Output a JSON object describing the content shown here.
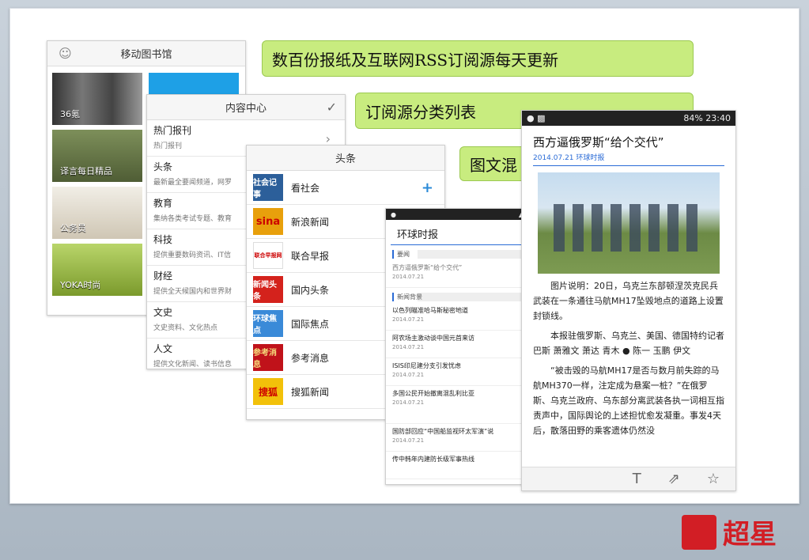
{
  "callouts": {
    "c1": "数百份报纸及互联网RSS订阅源每天更新",
    "c2": "订阅源分类列表",
    "c3": "图文混"
  },
  "library": {
    "title": "移动图书馆",
    "tiles": [
      {
        "label": "36氪"
      },
      {
        "label": "译言每日精品"
      },
      {
        "label": "公务员"
      },
      {
        "label": "YOKA时尚"
      }
    ]
  },
  "content_center": {
    "title": "内容中心",
    "categories": [
      {
        "title": "热门报刊",
        "desc": "热门报刊"
      },
      {
        "title": "头条",
        "desc": "最新最全要闻频道，网罗"
      },
      {
        "title": "教育",
        "desc": "集纳各类考试专题、教育"
      },
      {
        "title": "科技",
        "desc": "提供重要数码资讯、IT信"
      },
      {
        "title": "财经",
        "desc": "提供全天候国内和世界财"
      },
      {
        "title": "文史",
        "desc": "文史资料、文化热点"
      },
      {
        "title": "人文",
        "desc": "提供文化新闻、读书信息"
      }
    ]
  },
  "headlines": {
    "title": "头条",
    "items": [
      {
        "name": "看社会",
        "logo": "社会记事",
        "color": "#2c5f9a"
      },
      {
        "name": "新浪新闻",
        "logo": "sina",
        "color": "#e8a00c"
      },
      {
        "name": "联合早报",
        "logo": "联合早报网",
        "color": "#ffffff"
      },
      {
        "name": "国内头条",
        "logo": "新闻头条",
        "color": "#d4221c"
      },
      {
        "name": "国际焦点",
        "logo": "环球焦点",
        "color": "#3a8ad8"
      },
      {
        "name": "参考消息",
        "logo": "参考消息",
        "color": "#c0121a"
      },
      {
        "name": "搜狐新闻",
        "logo": "搜狐",
        "color": "#f2c10a"
      }
    ]
  },
  "news": {
    "title": "环球时报",
    "sec1": "要闻",
    "sec2": "新闻背景",
    "items": [
      {
        "t": "西方逼俄罗斯“给个交代”",
        "d": "2014.07.21"
      },
      {
        "t": "以色列瞄准哈马斯秘密地道",
        "d": "2014.07.21"
      },
      {
        "t": "阿农场主激动谈中国元首来访",
        "d": "2014.07.21"
      },
      {
        "t": "ISIS印尼建分支引发忧虑",
        "d": "2014.07.21"
      },
      {
        "t": "多国公民开始撤离混乱利比亚",
        "d": "2014.07.21"
      },
      {
        "t": "国防部回应“中国船监视环太军演”说",
        "d": "2014.07.21"
      },
      {
        "t": "传中韩年内建防长级军事热线",
        "d": ""
      }
    ]
  },
  "article": {
    "status_time": "23:40",
    "status_batt": "84%",
    "title": "西方逼俄罗斯“给个交代”",
    "meta": "2014.07.21 环球时报",
    "p1": "图片说明：20日，乌克兰东部顿涅茨克民兵武装在一条通往马航MH17坠毁地点的道路上设置封锁线。",
    "p2": "本报驻俄罗斯、乌克兰、美国、德国特约记者 巴斯 萧雅文 萧达 青木 ● 陈一 玉鹏 伊文",
    "p3": "“被击毁的马航MH17是否与数月前失踪的马航MH370一样，注定成为悬案一桩？”在俄罗斯、乌克兰政府、乌东部分离武装各执一词相互指责声中，国际舆论的上述担忧愈发凝重。事发4天后，散落田野的乘客遗体仍然没"
  },
  "brand": "超星",
  "icons": [
    "user-icon",
    "check-icon",
    "chevron-right-icon",
    "plus-icon",
    "text-icon",
    "share-icon",
    "star-icon"
  ]
}
